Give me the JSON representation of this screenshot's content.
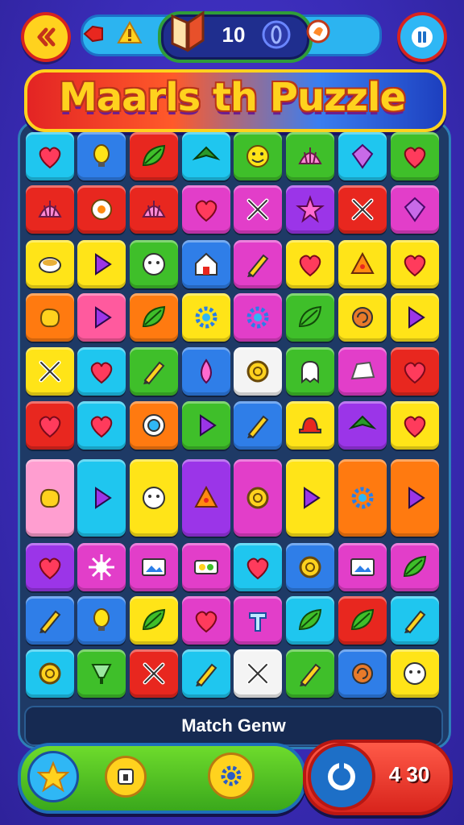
{
  "header": {
    "counter": "10",
    "title": "Maarls th Puzzle"
  },
  "footer": {
    "label": "Match Genw",
    "score": "4 30"
  },
  "icons": {
    "back": "back-arrows-icon",
    "pause": "pause-icon",
    "star": "star-icon",
    "box": "box-icon",
    "gear": "gear-icon",
    "refresh": "refresh-icon"
  },
  "colors": {
    "red": "#e8271f",
    "orange": "#ff7a10",
    "yellow": "#ffe418",
    "green": "#3fbf2a",
    "cyan": "#1fc6ef",
    "blue": "#2f7ee8",
    "purple": "#9b35e8",
    "magenta": "#e23ec9",
    "pink": "#ff5a9e",
    "white": "#f4f4f4",
    "lightpink": "#ff9ed0"
  },
  "board": {
    "rows": [
      [
        [
          "cyan",
          "heart-icon"
        ],
        [
          "blue",
          "bulb-icon"
        ],
        [
          "red",
          "leaf-icon"
        ],
        [
          "cyan",
          "bird-icon"
        ],
        [
          "green",
          "smiley-icon"
        ],
        [
          "green",
          "shell-icon"
        ],
        [
          "cyan",
          "gem-icon"
        ],
        [
          "green",
          "heart-icon"
        ]
      ],
      [
        [
          "red",
          "shell-icon"
        ],
        [
          "red",
          "flower-icon"
        ],
        [
          "red",
          "shell-icon"
        ],
        [
          "magenta",
          "heart-icon"
        ],
        [
          "magenta",
          "cross-icon"
        ],
        [
          "purple",
          "star-icon"
        ],
        [
          "red",
          "cross-icon"
        ],
        [
          "magenta",
          "gem-icon"
        ]
      ],
      [
        [
          "yellow",
          "bowl-icon"
        ],
        [
          "yellow",
          "triangle-icon"
        ],
        [
          "green",
          "face-icon"
        ],
        [
          "blue",
          "house-icon"
        ],
        [
          "magenta",
          "pencil-icon"
        ],
        [
          "yellow",
          "heart-icon"
        ],
        [
          "yellow",
          "pizza-icon"
        ],
        [
          "yellow",
          "heart-icon"
        ]
      ],
      [
        [
          "orange",
          "blob-icon"
        ],
        [
          "pink",
          "triangle-icon"
        ],
        [
          "orange",
          "leaf-icon"
        ],
        [
          "yellow",
          "gear-icon"
        ],
        [
          "magenta",
          "gear-icon"
        ],
        [
          "green",
          "leaf-icon"
        ],
        [
          "yellow",
          "swirl-icon"
        ],
        [
          "yellow",
          "triangle-icon"
        ]
      ],
      [
        [
          "yellow",
          "cross-icon"
        ],
        [
          "cyan",
          "heart-icon"
        ],
        [
          "green",
          "pencil-icon"
        ],
        [
          "blue",
          "drop-icon"
        ],
        [
          "white",
          "circle-icon"
        ],
        [
          "green",
          "ghost-icon"
        ],
        [
          "magenta",
          "rock-icon"
        ],
        [
          "red",
          "heart-icon"
        ]
      ],
      [
        [
          "red",
          "heart-icon"
        ],
        [
          "cyan",
          "heart-icon"
        ],
        [
          "orange",
          "eye-icon"
        ],
        [
          "green",
          "triangle-icon"
        ],
        [
          "blue",
          "pencil-icon"
        ],
        [
          "yellow",
          "hat-icon"
        ],
        [
          "purple",
          "bird-icon"
        ],
        [
          "yellow",
          "heart-icon"
        ]
      ]
    ],
    "tall_row": [
      [
        "lightpink",
        "blob-icon"
      ],
      [
        "cyan",
        "triangle-icon"
      ],
      [
        "yellow",
        "face-icon"
      ],
      [
        "purple",
        "pizza-icon"
      ],
      [
        "magenta",
        "circle-icon"
      ],
      [
        "yellow",
        "triangle-icon"
      ],
      [
        "orange",
        "gear-icon"
      ],
      [
        "orange",
        "triangle-icon"
      ]
    ],
    "bottom_rows": [
      [
        [
          "purple",
          "heart-icon"
        ],
        [
          "magenta",
          "sun-icon"
        ],
        [
          "magenta",
          "picture-icon"
        ],
        [
          "magenta",
          "glasses-icon"
        ],
        [
          "cyan",
          "heart-icon"
        ],
        [
          "blue",
          "circle-icon"
        ],
        [
          "magenta",
          "picture-icon"
        ],
        [
          "magenta",
          "leaf-icon"
        ]
      ],
      [
        [
          "blue",
          "pencil-icon"
        ],
        [
          "blue",
          "bulb-icon"
        ],
        [
          "yellow",
          "leaf-icon"
        ],
        [
          "magenta",
          "heart-icon"
        ],
        [
          "magenta",
          "tool-icon"
        ],
        [
          "cyan",
          "leaf-icon"
        ],
        [
          "red",
          "leaf-icon"
        ],
        [
          "cyan",
          "pencil-icon"
        ]
      ],
      [
        [
          "cyan",
          "circle-icon"
        ],
        [
          "green",
          "cup-icon"
        ],
        [
          "red",
          "cross-icon"
        ],
        [
          "cyan",
          "pencil-icon"
        ],
        [
          "white",
          "cross-icon"
        ],
        [
          "green",
          "pencil-icon"
        ],
        [
          "blue",
          "swirl-icon"
        ],
        [
          "yellow",
          "face-icon"
        ]
      ]
    ]
  }
}
